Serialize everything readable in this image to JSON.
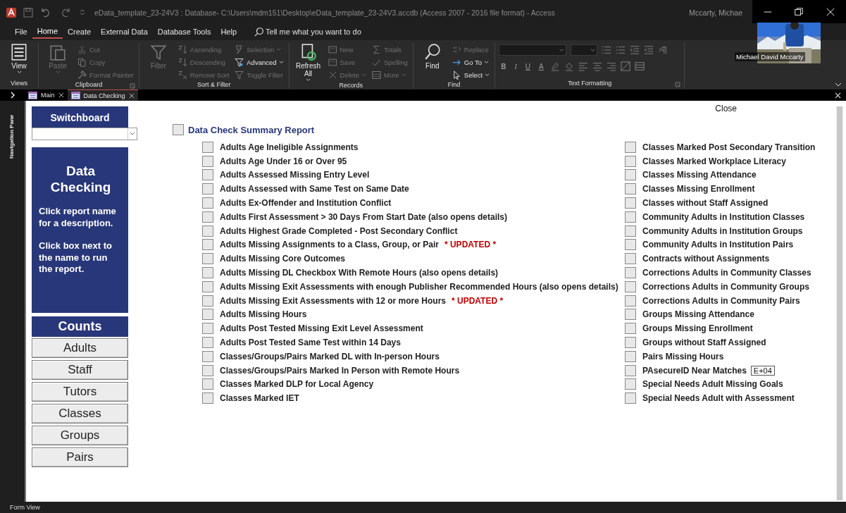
{
  "title_bar": {
    "title": "eData_template_23-24V3 : Database- C:\\Users\\mdm151\\Desktop\\eData_template_23-24V3.accdb (Access 2007 - 2016 file format)  -  Access",
    "user": "Mccarty, Michae"
  },
  "video_overlay": {
    "name": "Michael David Mccarty"
  },
  "menu_tabs": [
    {
      "label": "File",
      "selected": false
    },
    {
      "label": "Home",
      "selected": true
    },
    {
      "label": "Create",
      "selected": false
    },
    {
      "label": "External Data",
      "selected": false
    },
    {
      "label": "Database Tools",
      "selected": false
    },
    {
      "label": "Help",
      "selected": false
    }
  ],
  "search": {
    "placeholder": "Tell me what you want to do"
  },
  "ribbon": [
    {
      "name": "Views",
      "kind": "tools",
      "launcher": false,
      "columns": [
        [
          {
            "label": "View",
            "kind": "large",
            "disabled": false,
            "dropdown": true
          }
        ]
      ]
    },
    {
      "name": "Clipboard",
      "kind": "tools",
      "launcher": true,
      "columns": [
        [
          {
            "label": "Paste",
            "kind": "large",
            "disabled": true,
            "dropdown": true
          }
        ],
        [
          {
            "label": "Cut",
            "kind": "small",
            "disabled": true,
            "dropdown": false
          },
          {
            "label": "Copy",
            "kind": "small",
            "disabled": true,
            "dropdown": false
          },
          {
            "label": "Format Painter",
            "kind": "small",
            "disabled": true,
            "dropdown": false
          }
        ]
      ]
    },
    {
      "name": "Sort & Filter",
      "kind": "tools",
      "launcher": false,
      "columns": [
        [
          {
            "label": "Filter",
            "kind": "large",
            "disabled": true,
            "dropdown": false
          }
        ],
        [
          {
            "label": "Ascending",
            "kind": "small",
            "disabled": true,
            "dropdown": false
          },
          {
            "label": "Descending",
            "kind": "small",
            "disabled": true,
            "dropdown": false
          },
          {
            "label": "Remove Sort",
            "kind": "small",
            "disabled": true,
            "dropdown": false
          }
        ],
        [
          {
            "label": "Selection",
            "kind": "small",
            "disabled": true,
            "dropdown": true
          },
          {
            "label": "Advanced",
            "kind": "small",
            "disabled": false,
            "dropdown": true
          },
          {
            "label": "Toggle Filter",
            "kind": "small",
            "disabled": true,
            "dropdown": false
          }
        ]
      ]
    },
    {
      "name": "Records",
      "kind": "tools",
      "launcher": false,
      "columns": [
        [
          {
            "label": "Refresh All",
            "kind": "large",
            "disabled": false,
            "dropdown": true
          }
        ],
        [
          {
            "label": "New",
            "kind": "small",
            "disabled": true,
            "dropdown": false
          },
          {
            "label": "Save",
            "kind": "small",
            "disabled": true,
            "dropdown": false
          },
          {
            "label": "Delete",
            "kind": "small",
            "disabled": true,
            "dropdown": true
          }
        ],
        [
          {
            "label": "Totals",
            "kind": "small",
            "disabled": true,
            "dropdown": false
          },
          {
            "label": "Spelling",
            "kind": "small",
            "disabled": true,
            "dropdown": false
          },
          {
            "label": "More",
            "kind": "small",
            "disabled": true,
            "dropdown": true
          }
        ]
      ]
    },
    {
      "name": "Find",
      "kind": "tools",
      "launcher": false,
      "columns": [
        [
          {
            "label": "Find",
            "kind": "large",
            "disabled": false,
            "dropdown": false
          }
        ],
        [
          {
            "label": "Replace",
            "kind": "small",
            "disabled": true,
            "dropdown": false
          },
          {
            "label": "Go To",
            "kind": "small",
            "disabled": false,
            "dropdown": true
          },
          {
            "label": "Select",
            "kind": "small",
            "disabled": false,
            "dropdown": true
          }
        ]
      ]
    },
    {
      "name": "Text Formatting",
      "kind": "format",
      "launcher": true,
      "letters": [
        "B",
        "I",
        "U",
        "A"
      ]
    }
  ],
  "doc_tabs": [
    {
      "label": "Main",
      "selected": false
    },
    {
      "label": "Data Checking",
      "selected": true
    }
  ],
  "nav_pane": {
    "label": "Navigation Pane"
  },
  "sidebar": {
    "switchboard": "Switchboard",
    "panel_title": "Data Checking",
    "panel_paragraphs": [
      "Click report name for a description.",
      "Click box next to the name to run the report."
    ],
    "counts_title": "Counts",
    "counts": [
      "Adults",
      "Staff",
      "Tutors",
      "Classes",
      "Groups",
      "Pairs"
    ]
  },
  "close_button": "Close",
  "report": {
    "title": "Data Check Summary Report",
    "checked": false,
    "left": [
      {
        "label": "Adults Age Ineligible Assignments",
        "checked": false
      },
      {
        "label": "Adults Age Under 16 or Over 95",
        "checked": false
      },
      {
        "label": "Adults Assessed Missing Entry Level",
        "checked": false
      },
      {
        "label": "Adults Assessed with Same Test on Same Date",
        "checked": false
      },
      {
        "label": "Adults Ex-Offender and Institution Conflict",
        "checked": false
      },
      {
        "label": "Adults First Assessment > 30 Days From Start Date (also opens details)",
        "checked": false
      },
      {
        "label": "Adults Highest Grade Completed - Post Secondary Conflict",
        "checked": false
      },
      {
        "label": "Adults Missing Assignments to a Class, Group, or Pair",
        "note": "* UPDATED *",
        "checked": false
      },
      {
        "label": "Adults Missing Core Outcomes",
        "checked": false
      },
      {
        "label": "Adults Missing DL Checkbox With Remote Hours (also opens details)",
        "checked": false
      },
      {
        "label": "Adults Missing Exit Assessments with enough Publisher Recommended Hours (also opens details)",
        "checked": false
      },
      {
        "label": "Adults Missing Exit Assessments with 12 or more Hours",
        "note": "* UPDATED *",
        "checked": false
      },
      {
        "label": "Adults Missing Hours",
        "checked": false
      },
      {
        "label": "Adults Post Tested Missing Exit Level Assessment",
        "checked": false
      },
      {
        "label": "Adults Post Tested Same Test within 14 Days",
        "checked": false
      },
      {
        "label": "Classes/Groups/Pairs Marked DL with In-person Hours",
        "checked": false
      },
      {
        "label": "Classes/Groups/Pairs Marked In Person with Remote Hours",
        "checked": false
      },
      {
        "label": "Classes Marked DLP for Local Agency",
        "checked": false
      },
      {
        "label": "Classes Marked IET",
        "checked": false
      }
    ],
    "right": [
      {
        "label": "Classes Marked Post Secondary Transition",
        "checked": false
      },
      {
        "label": "Classes Marked Workplace Literacy",
        "checked": false
      },
      {
        "label": "Classes Missing Attendance",
        "checked": false
      },
      {
        "label": "Classes Missing Enrollment",
        "checked": false
      },
      {
        "label": "Classes without Staff Assigned",
        "checked": false
      },
      {
        "label": "Community Adults in Institution Classes",
        "checked": false
      },
      {
        "label": "Community Adults in Institution Groups",
        "checked": false
      },
      {
        "label": "Community Adults in Institution Pairs",
        "checked": false
      },
      {
        "label": "Contracts without Assignments",
        "checked": false
      },
      {
        "label": "Corrections Adults in Community Classes",
        "checked": false
      },
      {
        "label": "Corrections Adults in Community Groups",
        "checked": false
      },
      {
        "label": "Corrections Adults in Community Pairs",
        "checked": false
      },
      {
        "label": "Groups Missing Attendance",
        "checked": false
      },
      {
        "label": "Groups Missing Enrollment",
        "checked": false
      },
      {
        "label": "Groups without Staff Assigned",
        "checked": false
      },
      {
        "label": "Pairs Missing Hours",
        "checked": false
      },
      {
        "label": "PAsecureID Near Matches",
        "field": "E+04",
        "checked": false
      },
      {
        "label": "Special Needs Adult Missing Goals",
        "checked": false
      },
      {
        "label": "Special Needs Adult with Assessment",
        "checked": false
      }
    ]
  },
  "status_bar": "Form View"
}
